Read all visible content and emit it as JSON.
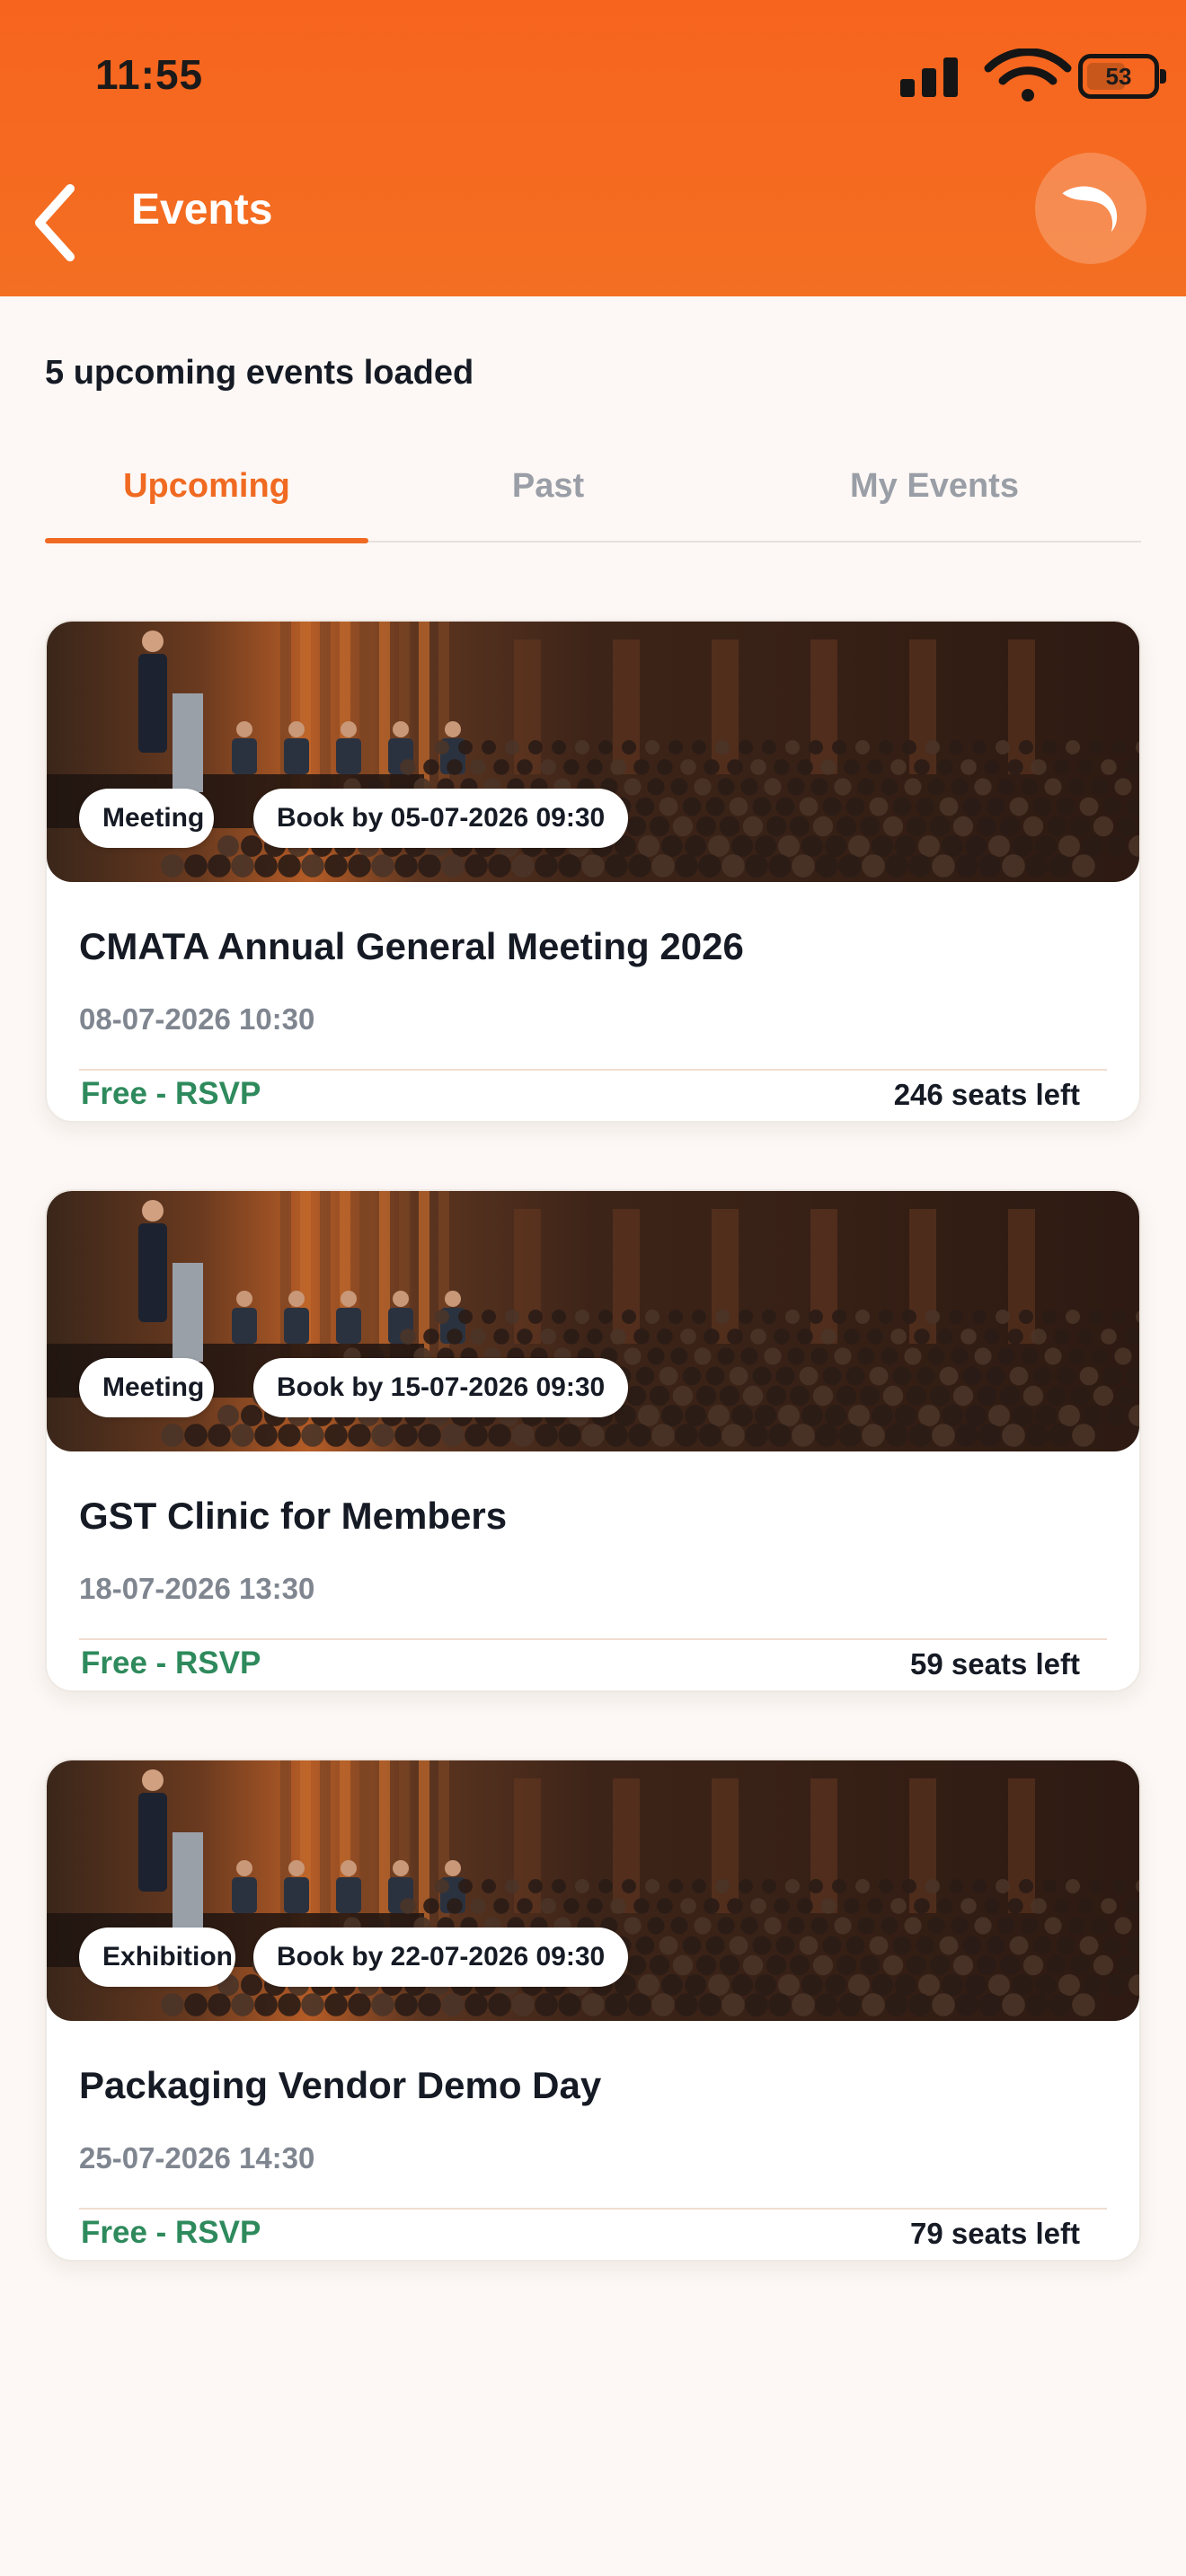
{
  "status_bar": {
    "time": "11:55",
    "battery": "53",
    "battery_level": 0.53
  },
  "header": {
    "title": "Events"
  },
  "summary": {
    "loaded_text": "5 upcoming events loaded"
  },
  "tabs": [
    {
      "label": "Upcoming",
      "active": true
    },
    {
      "label": "Past",
      "active": false
    },
    {
      "label": "My Events",
      "active": false
    }
  ],
  "events": [
    {
      "type": "Meeting",
      "book_by": "Book by 05-07-2026 09:30",
      "title": "CMATA Annual General Meeting 2026",
      "date": "08-07-2026 10:30",
      "price": "Free - RSVP",
      "seats": "246 seats left"
    },
    {
      "type": "Meeting",
      "book_by": "Book by 15-07-2026 09:30",
      "title": "GST Clinic for Members",
      "date": "18-07-2026 13:30",
      "price": "Free - RSVP",
      "seats": "59 seats left"
    },
    {
      "type": "Exhibition",
      "book_by": "Book by 22-07-2026 09:30",
      "title": "Packaging Vendor Demo Day",
      "date": "25-07-2026 14:30",
      "price": "Free - RSVP",
      "seats": "79 seats left"
    }
  ],
  "colors": {
    "header_bg": "#f7641e",
    "accent": "#f06a22",
    "price_green": "#2e8a5c",
    "page_bg": "#fdf8f5"
  },
  "icons": {
    "back": "chevron-left-icon",
    "theme": "moon-icon",
    "signal": "cellular-signal-icon",
    "wifi": "wifi-icon",
    "battery": "battery-icon"
  }
}
